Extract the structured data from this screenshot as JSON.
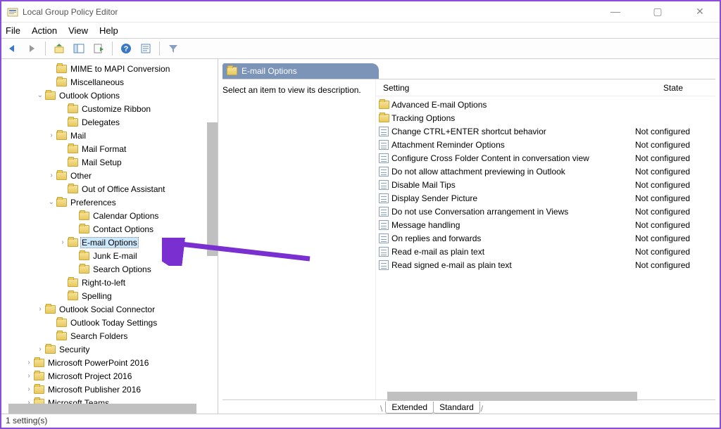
{
  "window": {
    "title": "Local Group Policy Editor",
    "controls": {
      "min": "—",
      "max": "▢",
      "close": "✕"
    }
  },
  "menubar": [
    "File",
    "Action",
    "View",
    "Help"
  ],
  "tree": [
    {
      "label": "MIME to MAPI Conversion",
      "indent": 4,
      "expander": ""
    },
    {
      "label": "Miscellaneous",
      "indent": 4,
      "expander": ""
    },
    {
      "label": "Outlook Options",
      "indent": 3,
      "expander": "v"
    },
    {
      "label": "Customize Ribbon",
      "indent": 5,
      "expander": ""
    },
    {
      "label": "Delegates",
      "indent": 5,
      "expander": ""
    },
    {
      "label": "Mail",
      "indent": 4,
      "expander": ">"
    },
    {
      "label": "Mail Format",
      "indent": 5,
      "expander": ""
    },
    {
      "label": "Mail Setup",
      "indent": 5,
      "expander": ""
    },
    {
      "label": "Other",
      "indent": 4,
      "expander": ">"
    },
    {
      "label": "Out of Office Assistant",
      "indent": 5,
      "expander": ""
    },
    {
      "label": "Preferences",
      "indent": 4,
      "expander": "v"
    },
    {
      "label": "Calendar Options",
      "indent": 6,
      "expander": ""
    },
    {
      "label": "Contact Options",
      "indent": 6,
      "expander": ""
    },
    {
      "label": "E-mail Options",
      "indent": 5,
      "expander": ">",
      "selected": true
    },
    {
      "label": "Junk E-mail",
      "indent": 6,
      "expander": ""
    },
    {
      "label": "Search Options",
      "indent": 6,
      "expander": ""
    },
    {
      "label": "Right-to-left",
      "indent": 5,
      "expander": ""
    },
    {
      "label": "Spelling",
      "indent": 5,
      "expander": ""
    },
    {
      "label": "Outlook Social Connector",
      "indent": 3,
      "expander": ">"
    },
    {
      "label": "Outlook Today Settings",
      "indent": 4,
      "expander": ""
    },
    {
      "label": "Search Folders",
      "indent": 4,
      "expander": ""
    },
    {
      "label": "Security",
      "indent": 3,
      "expander": ">"
    },
    {
      "label": "Microsoft PowerPoint 2016",
      "indent": 2,
      "expander": ">"
    },
    {
      "label": "Microsoft Project 2016",
      "indent": 2,
      "expander": ">"
    },
    {
      "label": "Microsoft Publisher 2016",
      "indent": 2,
      "expander": ">"
    },
    {
      "label": "Microsoft Teams",
      "indent": 2,
      "expander": ">"
    }
  ],
  "detail": {
    "header_title": "E-mail Options",
    "description_prompt": "Select an item to view its description.",
    "columns": {
      "setting": "Setting",
      "state": "State"
    },
    "items": [
      {
        "type": "folder",
        "name": "Advanced E-mail Options",
        "state": ""
      },
      {
        "type": "folder",
        "name": "Tracking Options",
        "state": ""
      },
      {
        "type": "policy",
        "name": "Change CTRL+ENTER shortcut behavior",
        "state": "Not configured"
      },
      {
        "type": "policy",
        "name": "Attachment Reminder Options",
        "state": "Not configured"
      },
      {
        "type": "policy",
        "name": "Configure Cross Folder Content in conversation view",
        "state": "Not configured"
      },
      {
        "type": "policy",
        "name": "Do not allow attachment previewing in Outlook",
        "state": "Not configured"
      },
      {
        "type": "policy",
        "name": "Disable Mail Tips",
        "state": "Not configured"
      },
      {
        "type": "policy",
        "name": "Display Sender Picture",
        "state": "Not configured"
      },
      {
        "type": "policy",
        "name": "Do not use Conversation arrangement in Views",
        "state": "Not configured"
      },
      {
        "type": "policy",
        "name": "Message handling",
        "state": "Not configured"
      },
      {
        "type": "policy",
        "name": "On replies and forwards",
        "state": "Not configured"
      },
      {
        "type": "policy",
        "name": "Read e-mail as plain text",
        "state": "Not configured"
      },
      {
        "type": "policy",
        "name": "Read signed e-mail as plain text",
        "state": "Not configured"
      }
    ]
  },
  "tabs": {
    "extended": "Extended",
    "standard": "Standard"
  },
  "statusbar": "1 setting(s)"
}
